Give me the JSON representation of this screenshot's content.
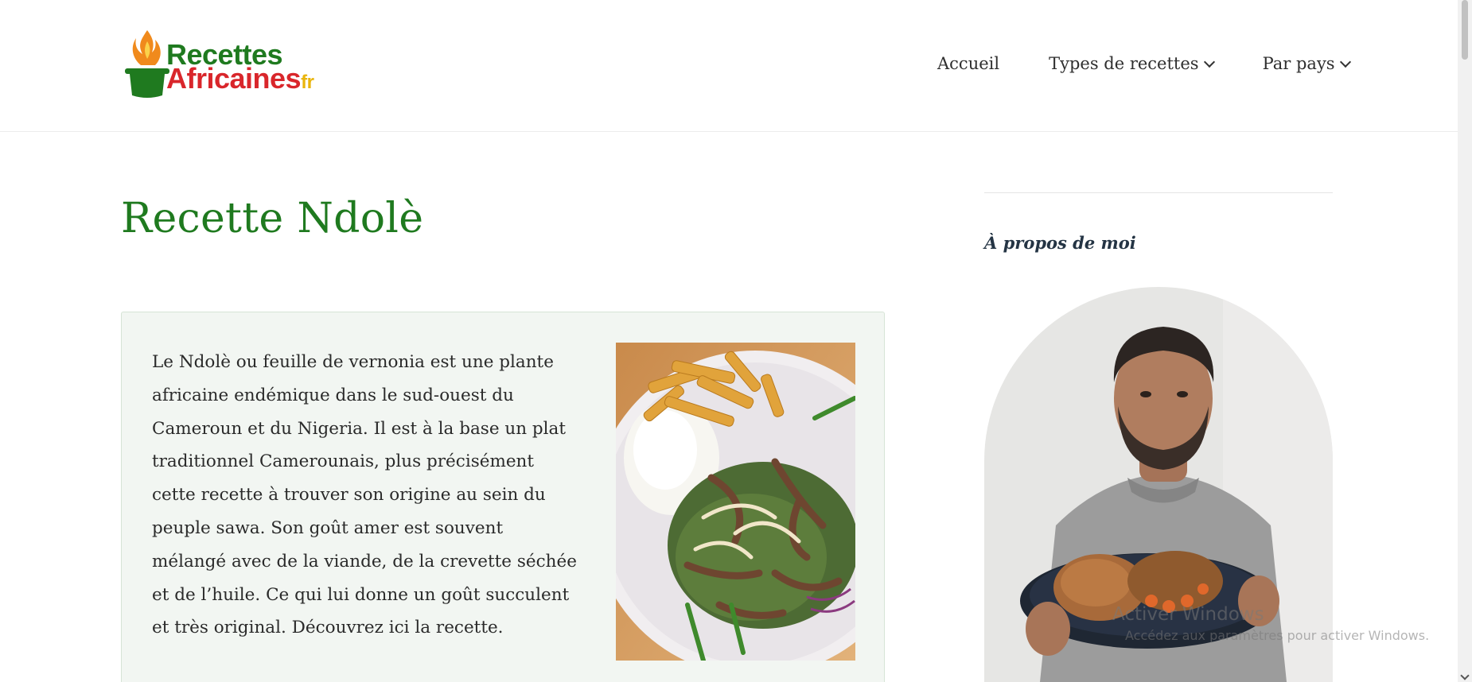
{
  "header": {
    "logo": {
      "line1": "Recettes",
      "line2": "Africaines",
      "suffix": "fr"
    },
    "nav": [
      {
        "label": "Accueil",
        "dropdown": false
      },
      {
        "label": "Types de recettes",
        "dropdown": true
      },
      {
        "label": "Par pays",
        "dropdown": true
      }
    ]
  },
  "main": {
    "title": "Recette Ndolè",
    "intro": "Le Ndolè ou feuille de vernonia est une plante africaine endémique dans le sud-ouest du Cameroun et du Nigeria. Il est à la base un plat traditionnel Camerounais, plus précisément cette recette à trouver son origine au sein du peuple sawa. Son goût amer est souvent mélangé avec de la viande, de la crevette séchée et de l’huile. Ce qui lui donne un goût succulent et très original. Découvrez ici la recette.",
    "photo_icon": "ndole-dish-photo"
  },
  "sidebar": {
    "title": "À propos de moi",
    "photo_icon": "author-photo"
  },
  "overlay": {
    "watermark_title": "Activer Windows",
    "watermark_sub": "Accédez aux paramètres pour activer Windows."
  },
  "colors": {
    "brand_green": "#1f7a1f",
    "brand_red": "#d9262b",
    "brand_yellow": "#e9b50c",
    "box_background": "#f2f6f2"
  }
}
